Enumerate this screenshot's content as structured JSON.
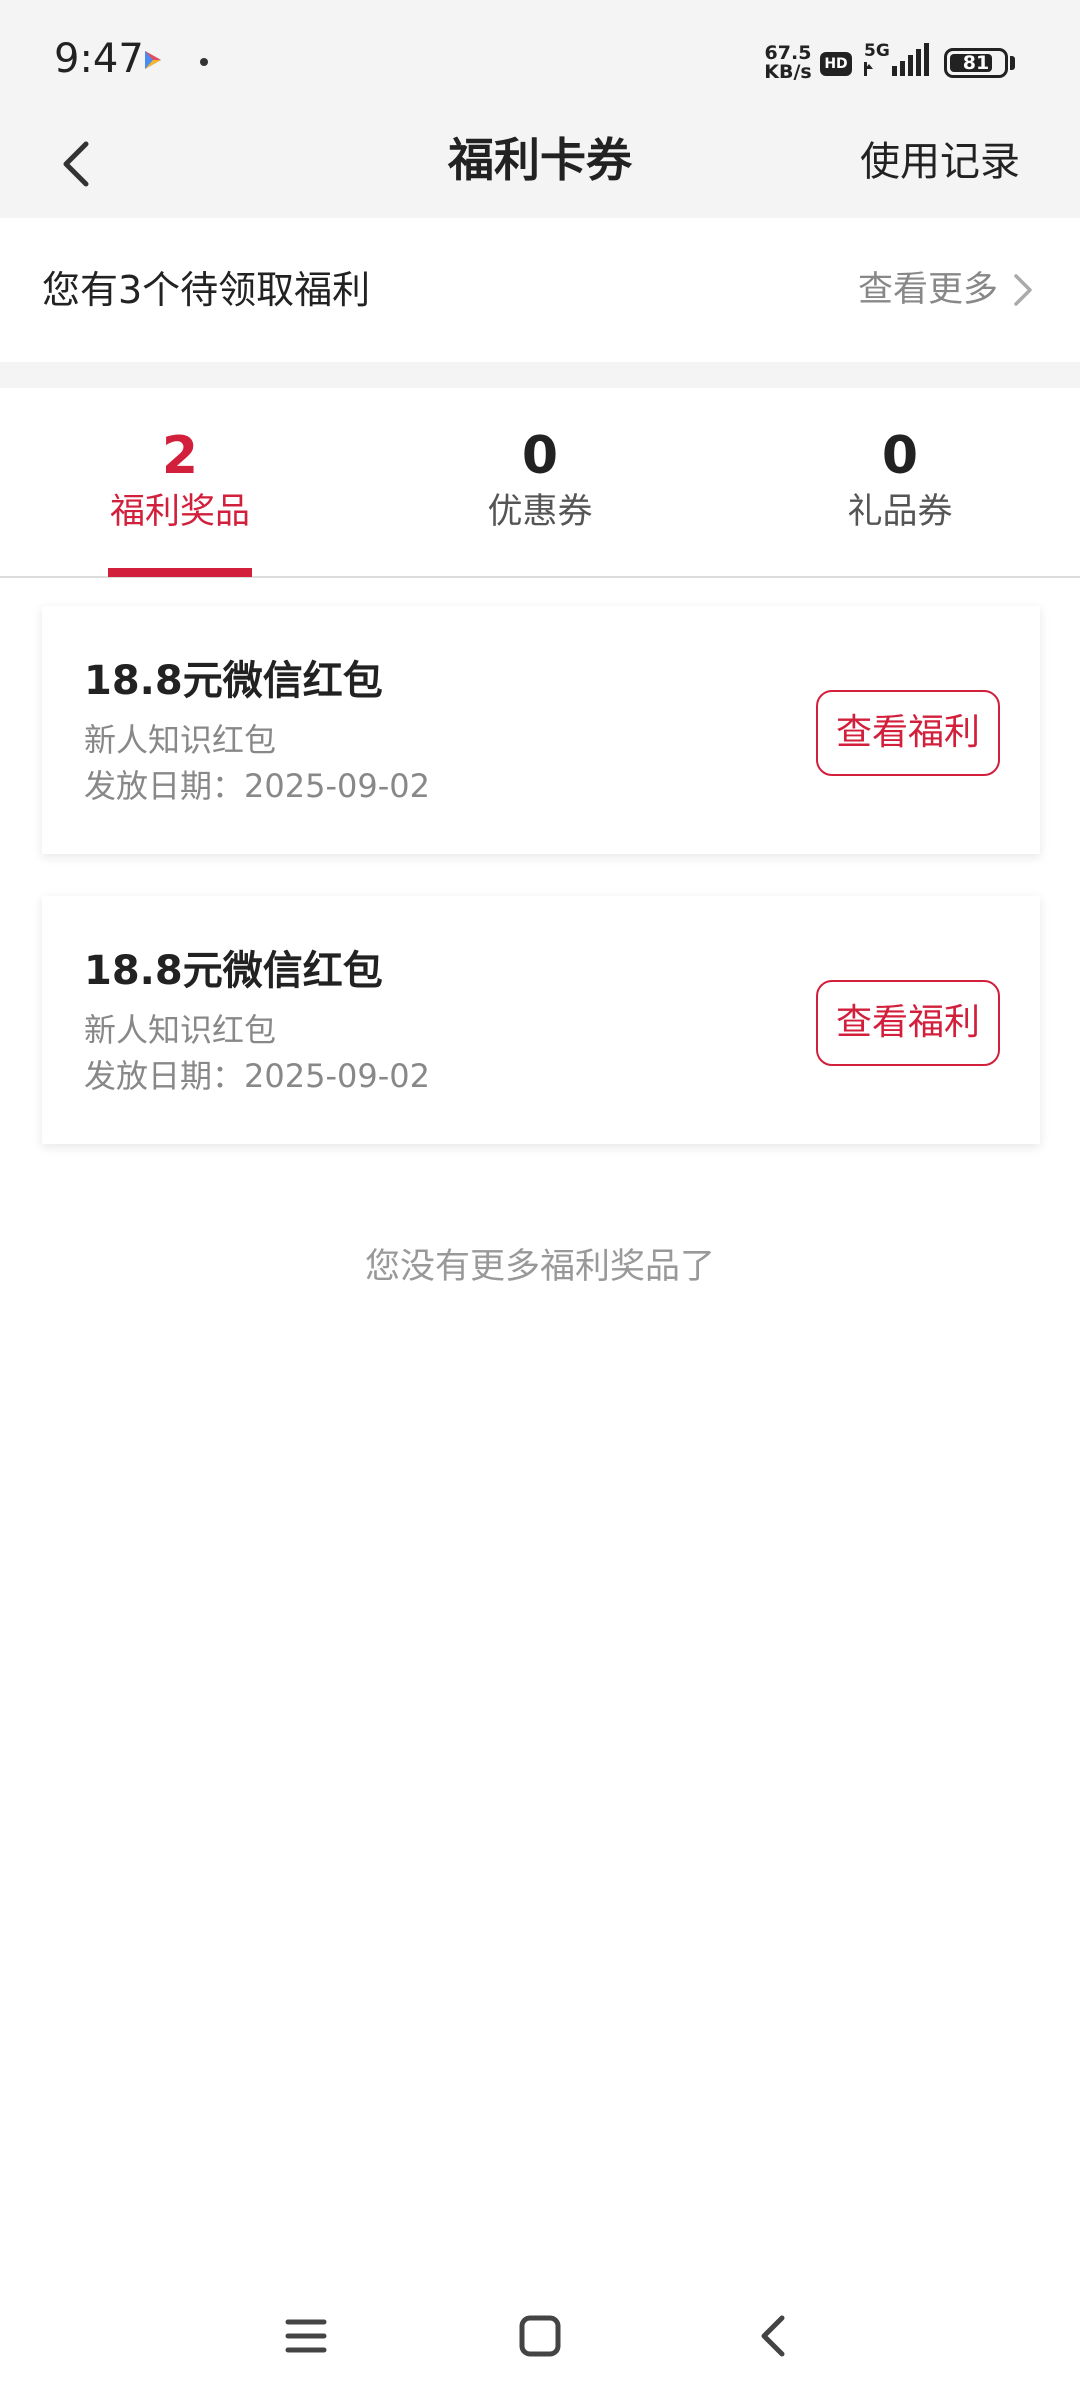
{
  "status_bar": {
    "time": "9:47",
    "net_speed_value": "67.5",
    "net_speed_unit": "KB/s",
    "hd_label": "HD",
    "network_label": "5G",
    "battery_level": 81,
    "battery_text": "81"
  },
  "header": {
    "title": "福利卡券",
    "history_link": "使用记录"
  },
  "pending": {
    "text": "您有3个待领取福利",
    "more": "查看更多"
  },
  "tabs": [
    {
      "count": "2",
      "label": "福利奖品",
      "active": true
    },
    {
      "count": "0",
      "label": "优惠券",
      "active": false
    },
    {
      "count": "0",
      "label": "礼品券",
      "active": false
    }
  ],
  "cards": [
    {
      "title": "18.8元微信红包",
      "subtitle": "新人知识红包",
      "date": "发放日期：2025-09-02",
      "button": "查看福利"
    },
    {
      "title": "18.8元微信红包",
      "subtitle": "新人知识红包",
      "date": "发放日期：2025-09-02",
      "button": "查看福利"
    }
  ],
  "end_text": "您没有更多福利奖品了",
  "colors": {
    "accent": "#d21f3c",
    "background_gray": "#f4f4f4",
    "text_primary": "#222222",
    "text_secondary": "#888888"
  },
  "icons": {
    "back": "chevron-left-icon",
    "more": "chevron-right-icon",
    "nav_menu": "menu-icon",
    "nav_home": "square-icon",
    "nav_back": "chevron-left-icon"
  }
}
